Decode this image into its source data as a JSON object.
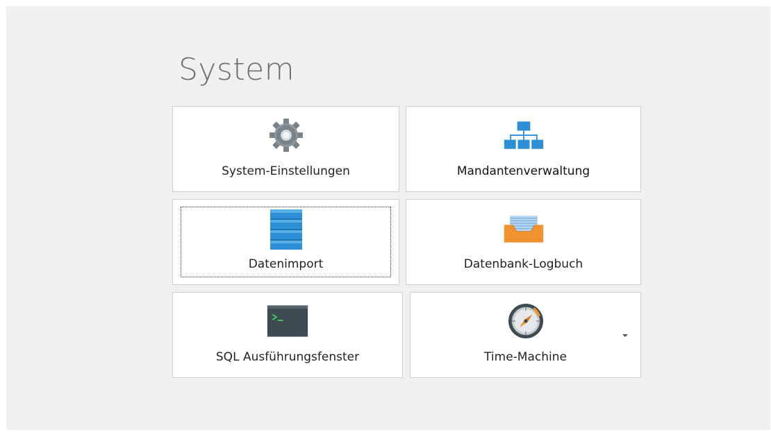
{
  "section": {
    "title": "System"
  },
  "tiles": [
    {
      "label": "System-Einstellungen",
      "icon": "gear-icon"
    },
    {
      "label": "Mandantenverwaltung",
      "icon": "org-chart-icon"
    },
    {
      "label": "Datenimport",
      "icon": "database-icon",
      "focused": true
    },
    {
      "label": "Datenbank-Logbuch",
      "icon": "inbox-log-icon"
    },
    {
      "label": "SQL Ausführungsfenster",
      "icon": "terminal-icon"
    },
    {
      "label": "Time-Machine",
      "icon": "compass-icon",
      "has_dropdown": true
    }
  ],
  "colors": {
    "background": "#f1f0ee",
    "tile_bg": "#ffffff",
    "tile_border": "#cfcfcf",
    "accent_blue": "#2d8fd5",
    "accent_orange": "#e8832e",
    "title_gray": "#6e6e6e"
  }
}
